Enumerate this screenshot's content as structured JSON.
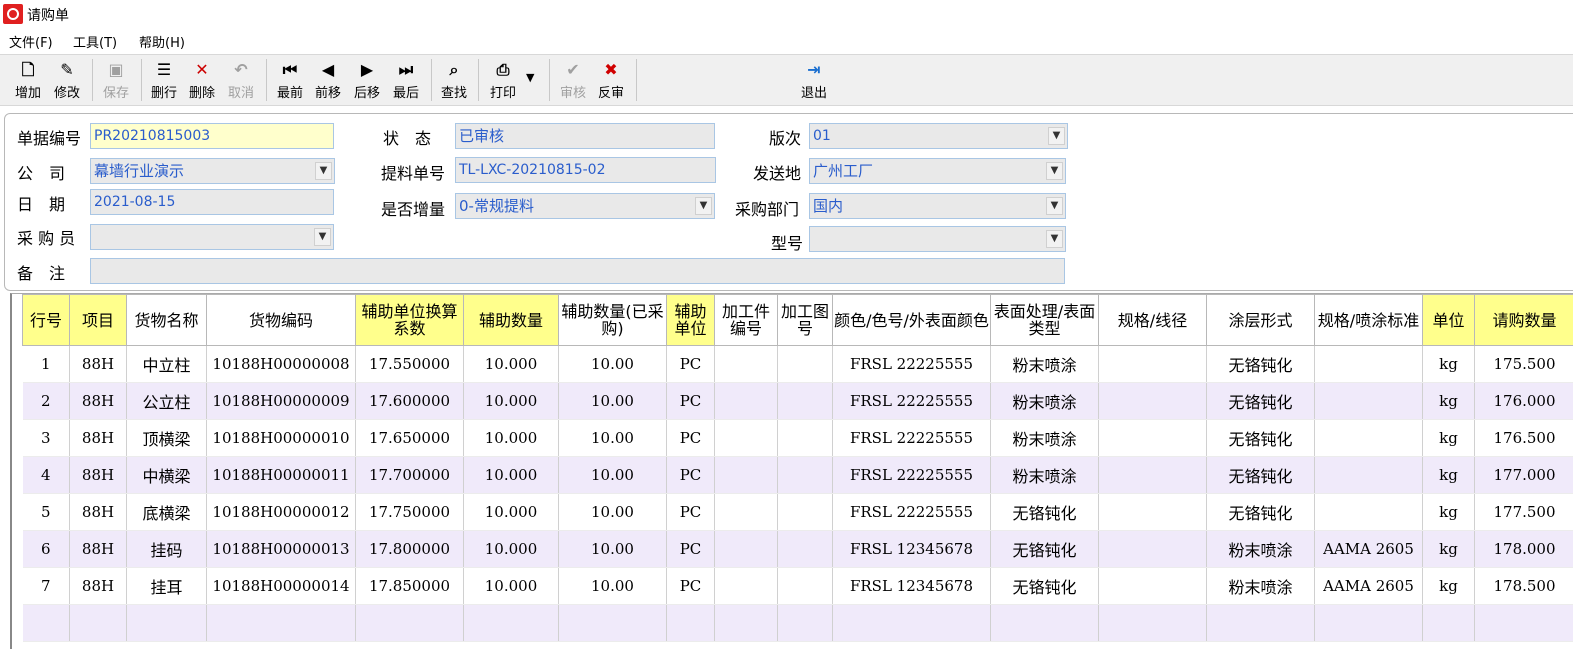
{
  "window": {
    "title": "请购单"
  },
  "menu": [
    "文件(F)",
    "工具(T)",
    "帮助(H)"
  ],
  "toolbar": {
    "add": "增加",
    "edit": "修改",
    "save": "保存",
    "delete_row": "删行",
    "delete": "删除",
    "cancel": "取消",
    "first": "最前",
    "prev": "前移",
    "next": "后移",
    "last": "最后",
    "find": "查找",
    "print": "打印",
    "review": "审核",
    "unreview": "反审",
    "exit": "退出"
  },
  "form": {
    "doc_no_label": "单据编号",
    "doc_no": "PR20210815003",
    "status_label": "状　态",
    "status": "已审核",
    "version_label": "版次",
    "version": "01",
    "company_label": "公　司",
    "company": "幕墙行业演示",
    "pick_no_label": "提料单号",
    "pick_no": "TL-LXC-20210815-02",
    "ship_label": "发送地",
    "ship": "广州工厂",
    "date_label": "日　期",
    "date": "2021-08-15",
    "increase_label": "是否增量",
    "increase": "0-常规提料",
    "dept_label": "采购部门",
    "dept": "国内",
    "buyer_label": "采 购 员",
    "buyer": "",
    "model_label": "型号",
    "model": "",
    "note_label": "备　注",
    "note": ""
  },
  "grid": {
    "columns": [
      "行号",
      "项目",
      "货物名称",
      "货物编码",
      "辅助单位换算系数",
      "辅助数量",
      "辅助数量(已采购)",
      "辅助单位",
      "加工件编号",
      "加工图号",
      "颜色/色号/外表面颜色",
      "表面处理/表面类型",
      "规格/线径",
      "涂层形式",
      "规格/喷涂标准",
      "单位",
      "请购数量"
    ],
    "rows": [
      [
        "1",
        "88H",
        "中立柱",
        "10188H00000008",
        "17.550000",
        "10.000",
        "10.00",
        "PC",
        "",
        "",
        "FRSL 22225555",
        "粉末喷涂",
        "",
        "无铬钝化",
        "",
        "kg",
        "175.500"
      ],
      [
        "2",
        "88H",
        "公立柱",
        "10188H00000009",
        "17.600000",
        "10.000",
        "10.00",
        "PC",
        "",
        "",
        "FRSL 22225555",
        "粉末喷涂",
        "",
        "无铬钝化",
        "",
        "kg",
        "176.000"
      ],
      [
        "3",
        "88H",
        "顶横梁",
        "10188H00000010",
        "17.650000",
        "10.000",
        "10.00",
        "PC",
        "",
        "",
        "FRSL 22225555",
        "粉末喷涂",
        "",
        "无铬钝化",
        "",
        "kg",
        "176.500"
      ],
      [
        "4",
        "88H",
        "中横梁",
        "10188H00000011",
        "17.700000",
        "10.000",
        "10.00",
        "PC",
        "",
        "",
        "FRSL 22225555",
        "粉末喷涂",
        "",
        "无铬钝化",
        "",
        "kg",
        "177.000"
      ],
      [
        "5",
        "88H",
        "底横梁",
        "10188H00000012",
        "17.750000",
        "10.000",
        "10.00",
        "PC",
        "",
        "",
        "FRSL 22225555",
        "无铬钝化",
        "",
        "无铬钝化",
        "",
        "kg",
        "177.500"
      ],
      [
        "6",
        "88H",
        "挂码",
        "10188H00000013",
        "17.800000",
        "10.000",
        "10.00",
        "PC",
        "",
        "",
        "FRSL 12345678",
        "无铬钝化",
        "",
        "粉末喷涂",
        "AAMA 2605",
        "kg",
        "178.000"
      ],
      [
        "7",
        "88H",
        "挂耳",
        "10188H00000014",
        "17.850000",
        "10.000",
        "10.00",
        "PC",
        "",
        "",
        "FRSL 12345678",
        "无铬钝化",
        "",
        "粉末喷涂",
        "AAMA 2605",
        "kg",
        "178.500"
      ]
    ]
  }
}
